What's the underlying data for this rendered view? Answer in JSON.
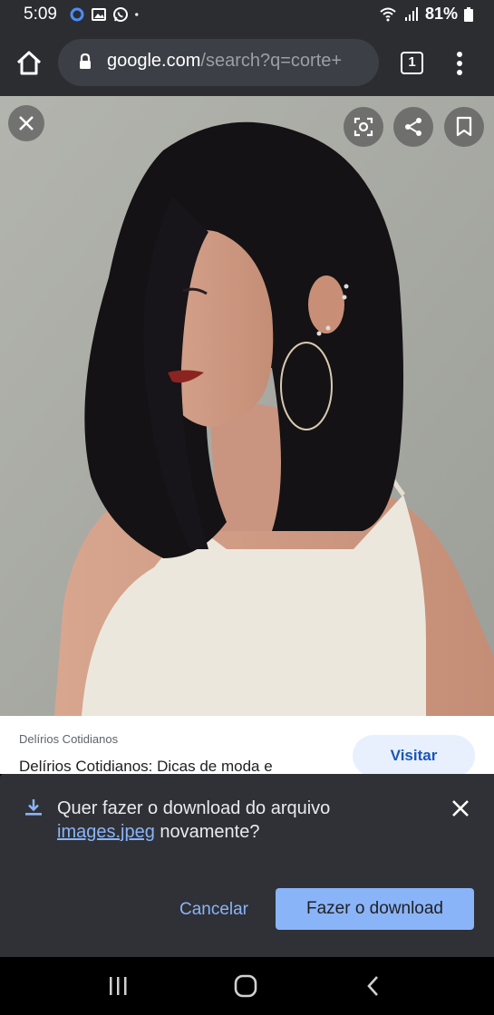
{
  "status_bar": {
    "time": "5:09",
    "battery": "81%",
    "icons": [
      "data-saver-icon",
      "image-icon",
      "whatsapp-icon",
      "dot-icon",
      "wifi-icon",
      "signal-icon",
      "battery-icon"
    ]
  },
  "browser": {
    "url_host": "google.com",
    "url_path": "/search?q=corte+",
    "tab_count": "1"
  },
  "result": {
    "source": "Delírios Cotidianos",
    "title": "Delírios Cotidianos: Dicas de moda e",
    "visit_label": "Visitar"
  },
  "download_prompt": {
    "message_before": "Quer fazer o download do arquivo",
    "file_name": "images.jpeg",
    "message_after": " novamente?",
    "cancel_label": "Cancelar",
    "confirm_label": "Fazer o download"
  },
  "colors": {
    "toolbar": "#2b2d31",
    "accent": "#8ab4f8",
    "visit_bg": "#e8f0fe"
  }
}
